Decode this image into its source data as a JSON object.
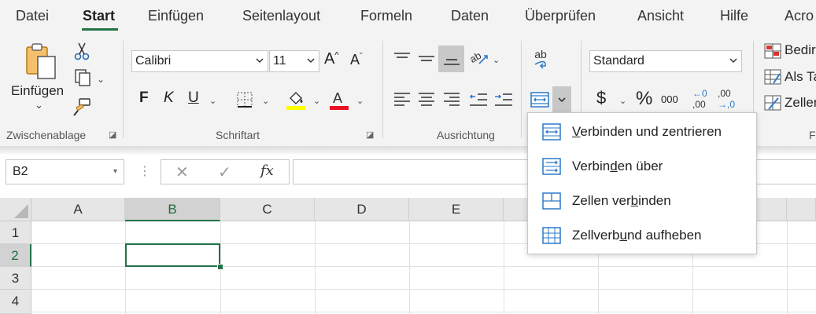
{
  "tabs": [
    {
      "label": "Datei",
      "active": false
    },
    {
      "label": "Start",
      "active": true
    },
    {
      "label": "Einfügen",
      "active": false
    },
    {
      "label": "Seitenlayout",
      "active": false
    },
    {
      "label": "Formeln",
      "active": false
    },
    {
      "label": "Daten",
      "active": false
    },
    {
      "label": "Überprüfen",
      "active": false
    },
    {
      "label": "Ansicht",
      "active": false
    },
    {
      "label": "Hilfe",
      "active": false
    },
    {
      "label": "Acro",
      "active": false
    }
  ],
  "ribbon": {
    "clipboard": {
      "paste_label": "Einfügen",
      "paste_caret": "⌄",
      "group_label": "Zwischenablage"
    },
    "font": {
      "font_name": "Calibri",
      "font_size": "11",
      "grow": "A",
      "shrink": "A",
      "bold": "F",
      "italic": "K",
      "underline": "U",
      "group_label": "Schriftart",
      "highlight_color": "#ffff00",
      "font_color": "#e81123"
    },
    "alignment": {
      "group_label": "Ausrichtung",
      "wrap_label": "ab"
    },
    "number": {
      "format": "Standard",
      "currency": "$",
      "percent": "%",
      "thousands": "000",
      "dec_inc_top": "←0",
      "dec_inc_bottom": ",00",
      "dec_dec_top": ",00",
      "dec_dec_bottom": "→,0"
    },
    "styles": {
      "cond_format": "Bedir",
      "as_table": "Als Ta",
      "cell_styles": "Zeller",
      "group_letter": "F"
    }
  },
  "namebox": {
    "value": "B2"
  },
  "formula_bar": {
    "fx": "fx",
    "value": ""
  },
  "grid": {
    "columns": [
      "A",
      "B",
      "C",
      "D",
      "E"
    ],
    "rows": [
      "1",
      "2",
      "3",
      "4"
    ],
    "selected_cell": "B2",
    "accent": "#217346"
  },
  "merge_menu": {
    "items": [
      {
        "pre": "",
        "ul": "V",
        "post": "erbinden und zentrieren"
      },
      {
        "pre": "Verbin",
        "ul": "d",
        "post": "en über"
      },
      {
        "pre": "Zellen ver",
        "ul": "b",
        "post": "inden"
      },
      {
        "pre": "Zellverb",
        "ul": "u",
        "post": "nd aufheben"
      }
    ]
  }
}
